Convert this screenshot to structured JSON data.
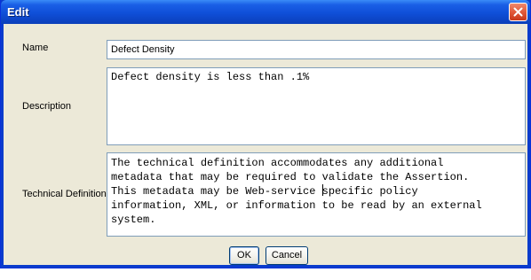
{
  "window": {
    "title": "Edit"
  },
  "form": {
    "name_label": "Name",
    "name_value": "Defect Density",
    "description_label": "Description",
    "description_value": "Defect density is less than .1%",
    "technical_label": "Technical Definition",
    "technical_lines": [
      "The technical definition accommodates any additional",
      "metadata that may be required to validate the Assertion.",
      "This metadata may be Web-service ",
      "specific policy",
      "information, XML, or information to be read by an external",
      "system."
    ]
  },
  "buttons": {
    "ok_label": "OK",
    "cancel_label": "Cancel"
  },
  "icons": {
    "close": "close-x-icon"
  },
  "colors": {
    "title_bar": "#0f4fd8",
    "close_button": "#e25a3a",
    "dialog_background": "#ece9d8",
    "field_border": "#7f9db9"
  }
}
